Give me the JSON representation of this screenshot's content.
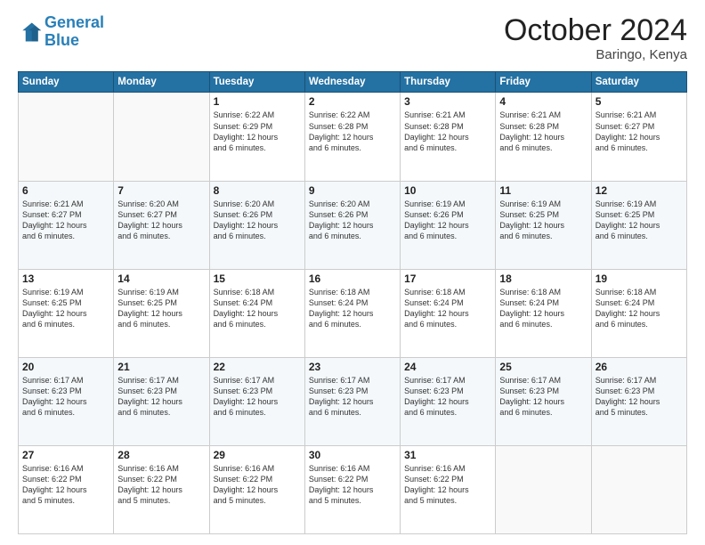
{
  "logo": {
    "line1": "General",
    "line2": "Blue"
  },
  "header": {
    "month": "October 2024",
    "location": "Baringo, Kenya"
  },
  "weekdays": [
    "Sunday",
    "Monday",
    "Tuesday",
    "Wednesday",
    "Thursday",
    "Friday",
    "Saturday"
  ],
  "weeks": [
    [
      {
        "day": "",
        "info": ""
      },
      {
        "day": "",
        "info": ""
      },
      {
        "day": "1",
        "info": "Sunrise: 6:22 AM\nSunset: 6:29 PM\nDaylight: 12 hours\nand 6 minutes."
      },
      {
        "day": "2",
        "info": "Sunrise: 6:22 AM\nSunset: 6:28 PM\nDaylight: 12 hours\nand 6 minutes."
      },
      {
        "day": "3",
        "info": "Sunrise: 6:21 AM\nSunset: 6:28 PM\nDaylight: 12 hours\nand 6 minutes."
      },
      {
        "day": "4",
        "info": "Sunrise: 6:21 AM\nSunset: 6:28 PM\nDaylight: 12 hours\nand 6 minutes."
      },
      {
        "day": "5",
        "info": "Sunrise: 6:21 AM\nSunset: 6:27 PM\nDaylight: 12 hours\nand 6 minutes."
      }
    ],
    [
      {
        "day": "6",
        "info": "Sunrise: 6:21 AM\nSunset: 6:27 PM\nDaylight: 12 hours\nand 6 minutes."
      },
      {
        "day": "7",
        "info": "Sunrise: 6:20 AM\nSunset: 6:27 PM\nDaylight: 12 hours\nand 6 minutes."
      },
      {
        "day": "8",
        "info": "Sunrise: 6:20 AM\nSunset: 6:26 PM\nDaylight: 12 hours\nand 6 minutes."
      },
      {
        "day": "9",
        "info": "Sunrise: 6:20 AM\nSunset: 6:26 PM\nDaylight: 12 hours\nand 6 minutes."
      },
      {
        "day": "10",
        "info": "Sunrise: 6:19 AM\nSunset: 6:26 PM\nDaylight: 12 hours\nand 6 minutes."
      },
      {
        "day": "11",
        "info": "Sunrise: 6:19 AM\nSunset: 6:25 PM\nDaylight: 12 hours\nand 6 minutes."
      },
      {
        "day": "12",
        "info": "Sunrise: 6:19 AM\nSunset: 6:25 PM\nDaylight: 12 hours\nand 6 minutes."
      }
    ],
    [
      {
        "day": "13",
        "info": "Sunrise: 6:19 AM\nSunset: 6:25 PM\nDaylight: 12 hours\nand 6 minutes."
      },
      {
        "day": "14",
        "info": "Sunrise: 6:19 AM\nSunset: 6:25 PM\nDaylight: 12 hours\nand 6 minutes."
      },
      {
        "day": "15",
        "info": "Sunrise: 6:18 AM\nSunset: 6:24 PM\nDaylight: 12 hours\nand 6 minutes."
      },
      {
        "day": "16",
        "info": "Sunrise: 6:18 AM\nSunset: 6:24 PM\nDaylight: 12 hours\nand 6 minutes."
      },
      {
        "day": "17",
        "info": "Sunrise: 6:18 AM\nSunset: 6:24 PM\nDaylight: 12 hours\nand 6 minutes."
      },
      {
        "day": "18",
        "info": "Sunrise: 6:18 AM\nSunset: 6:24 PM\nDaylight: 12 hours\nand 6 minutes."
      },
      {
        "day": "19",
        "info": "Sunrise: 6:18 AM\nSunset: 6:24 PM\nDaylight: 12 hours\nand 6 minutes."
      }
    ],
    [
      {
        "day": "20",
        "info": "Sunrise: 6:17 AM\nSunset: 6:23 PM\nDaylight: 12 hours\nand 6 minutes."
      },
      {
        "day": "21",
        "info": "Sunrise: 6:17 AM\nSunset: 6:23 PM\nDaylight: 12 hours\nand 6 minutes."
      },
      {
        "day": "22",
        "info": "Sunrise: 6:17 AM\nSunset: 6:23 PM\nDaylight: 12 hours\nand 6 minutes."
      },
      {
        "day": "23",
        "info": "Sunrise: 6:17 AM\nSunset: 6:23 PM\nDaylight: 12 hours\nand 6 minutes."
      },
      {
        "day": "24",
        "info": "Sunrise: 6:17 AM\nSunset: 6:23 PM\nDaylight: 12 hours\nand 6 minutes."
      },
      {
        "day": "25",
        "info": "Sunrise: 6:17 AM\nSunset: 6:23 PM\nDaylight: 12 hours\nand 6 minutes."
      },
      {
        "day": "26",
        "info": "Sunrise: 6:17 AM\nSunset: 6:23 PM\nDaylight: 12 hours\nand 5 minutes."
      }
    ],
    [
      {
        "day": "27",
        "info": "Sunrise: 6:16 AM\nSunset: 6:22 PM\nDaylight: 12 hours\nand 5 minutes."
      },
      {
        "day": "28",
        "info": "Sunrise: 6:16 AM\nSunset: 6:22 PM\nDaylight: 12 hours\nand 5 minutes."
      },
      {
        "day": "29",
        "info": "Sunrise: 6:16 AM\nSunset: 6:22 PM\nDaylight: 12 hours\nand 5 minutes."
      },
      {
        "day": "30",
        "info": "Sunrise: 6:16 AM\nSunset: 6:22 PM\nDaylight: 12 hours\nand 5 minutes."
      },
      {
        "day": "31",
        "info": "Sunrise: 6:16 AM\nSunset: 6:22 PM\nDaylight: 12 hours\nand 5 minutes."
      },
      {
        "day": "",
        "info": ""
      },
      {
        "day": "",
        "info": ""
      }
    ]
  ]
}
